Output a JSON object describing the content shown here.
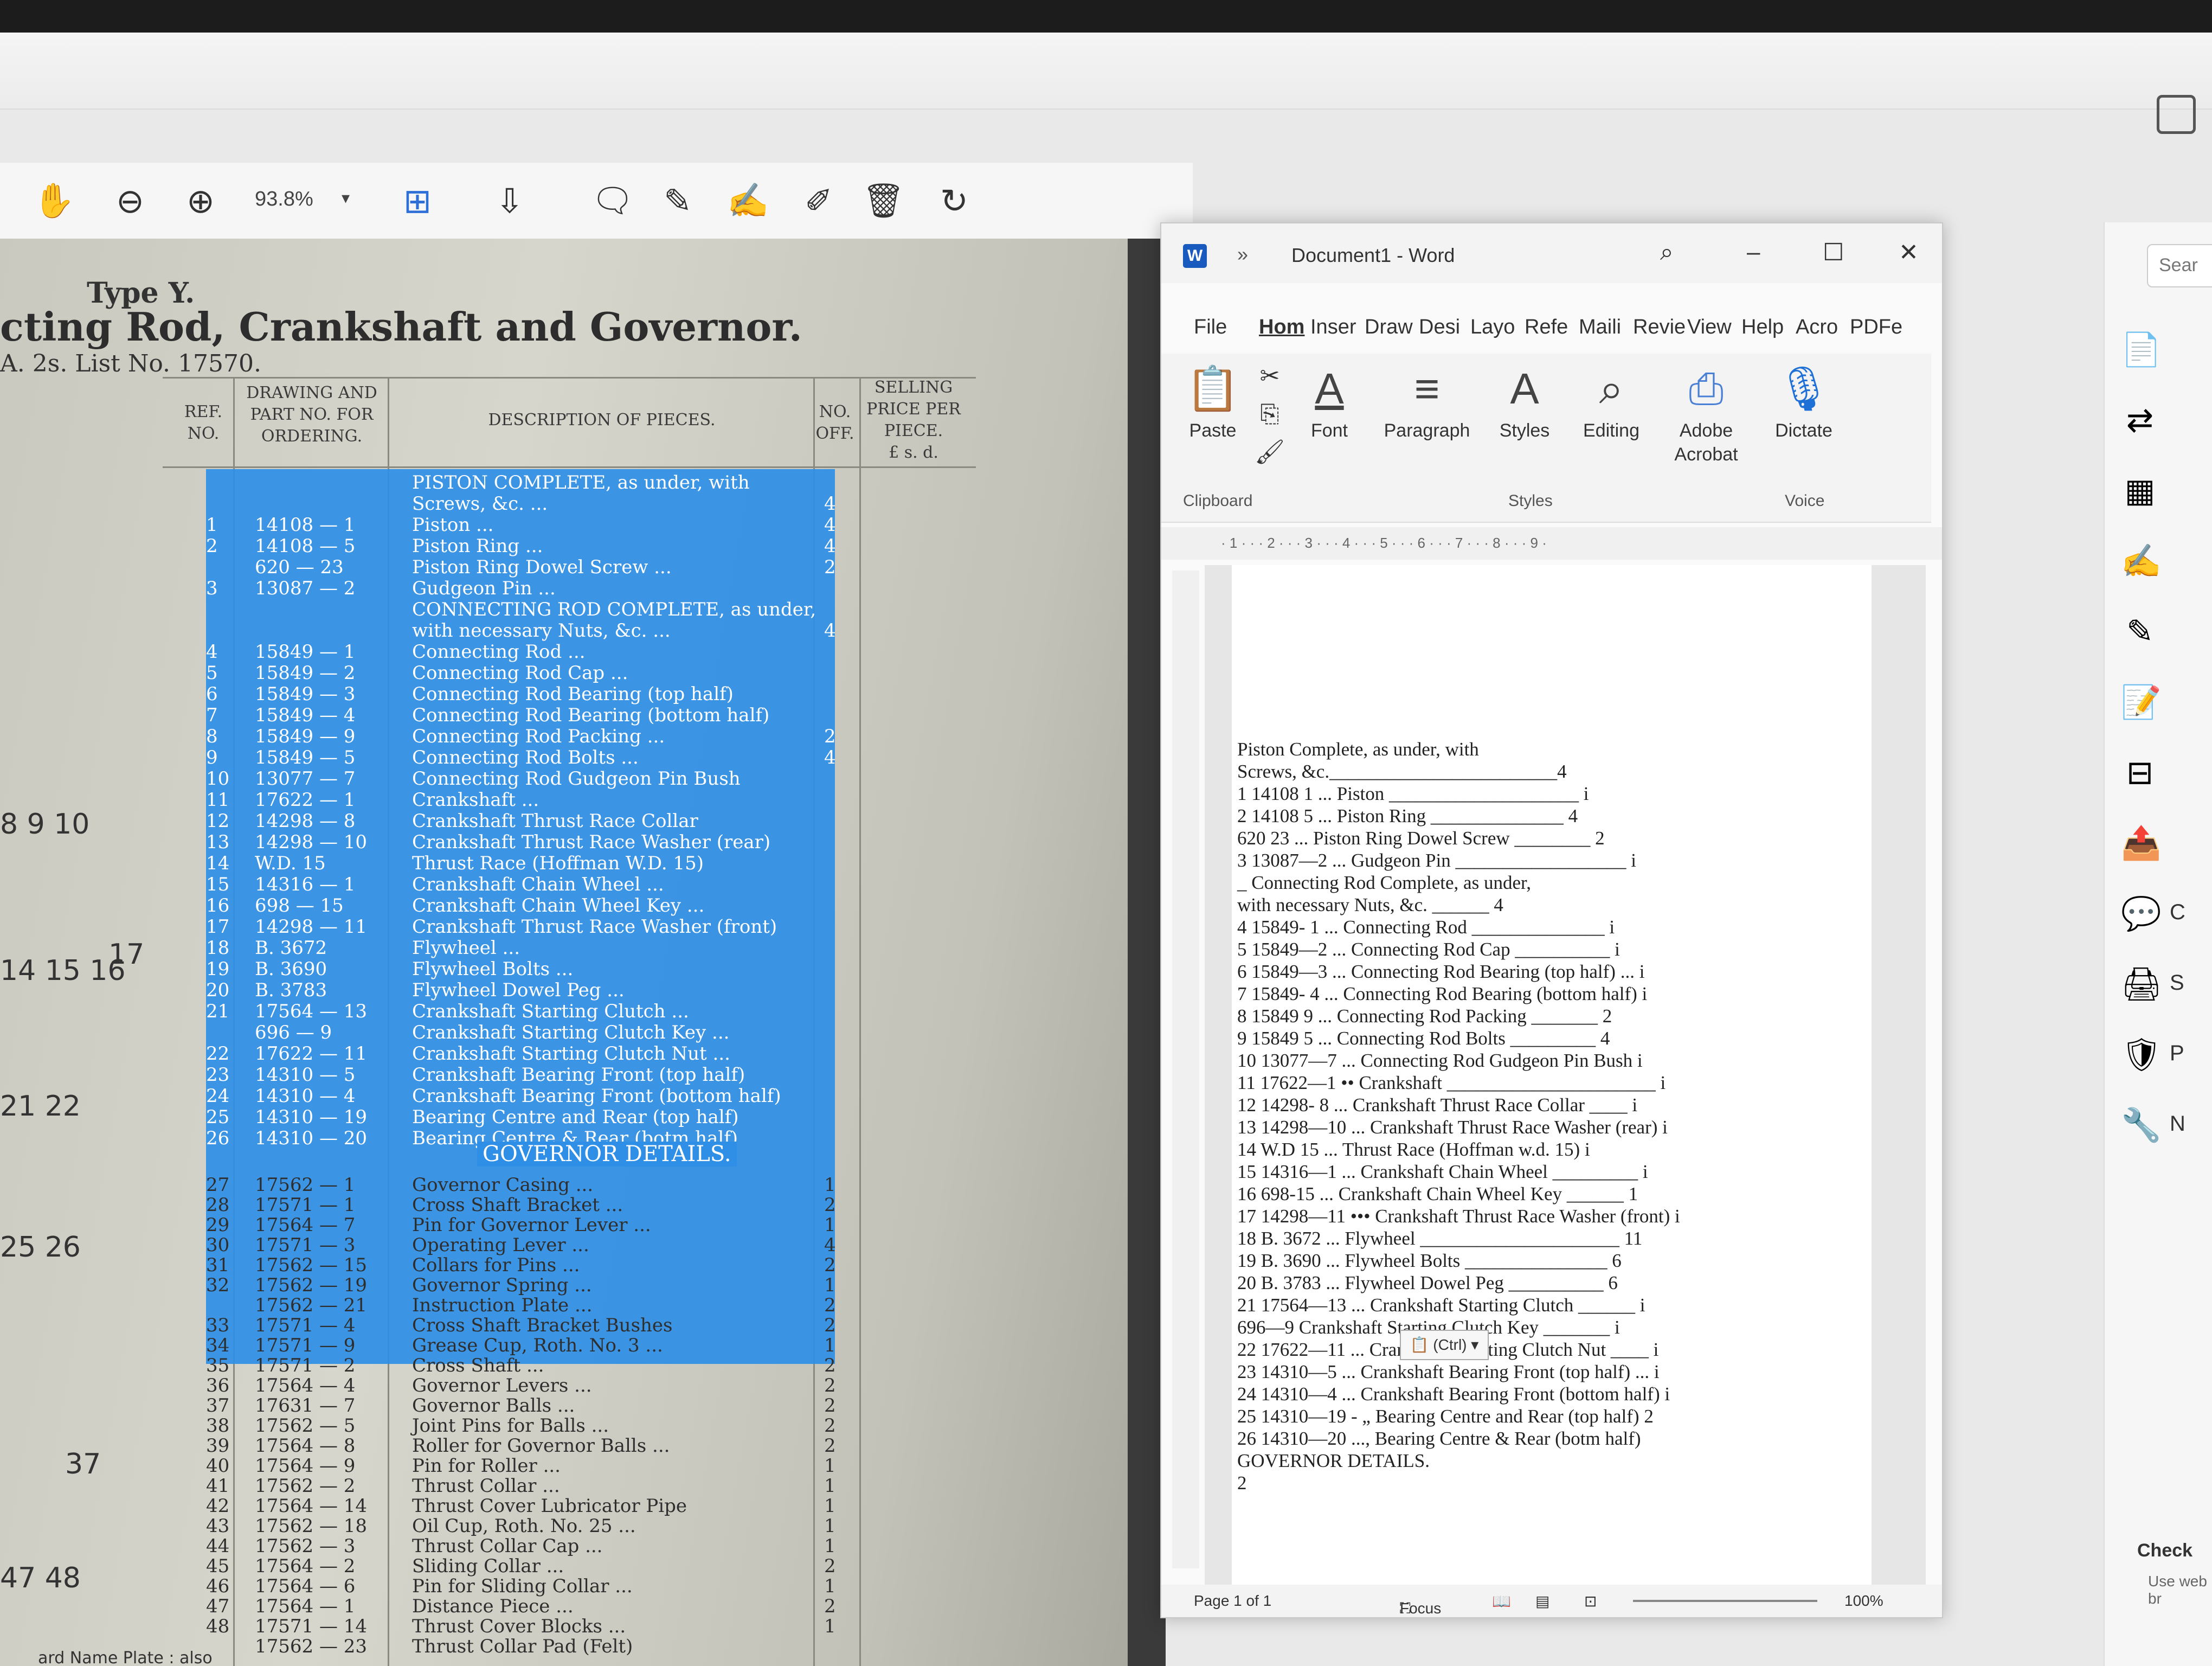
{
  "pdf_toolbar": {
    "zoom": "93.8%",
    "tools": [
      "hand-icon",
      "zoom-out-icon",
      "zoom-in-icon",
      "zoom-caret",
      "fit-page-icon",
      "scroll-mode-icon",
      "comment-icon",
      "highlight-icon",
      "sign-icon",
      "edit-icon",
      "delete-icon",
      "rotate-icon"
    ]
  },
  "scan": {
    "type_label": "Type Y.",
    "title": "cting  Rod,  Crankshaft  and  Governor.",
    "subtitle": "A.  2s.       List No. 17570.",
    "col_ref": "REF. NO.",
    "col_part": "DRAWING AND PART NO. FOR ORDERING.",
    "col_desc": "DESCRIPTION  OF  PIECES.",
    "col_no": "NO. OFF.",
    "col_price": "SELLING PRICE PER PIECE.",
    "col_price_units": "£  s.  d.",
    "figure_numbers": [
      "8   9   10",
      "14 15 16",
      "17",
      "21   22",
      "25   26",
      "37",
      "47   48"
    ],
    "footer": "ard Name Plate : also",
    "govern_title": "GOVERNOR  DETAILS.",
    "selected_rows": [
      {
        "ref": "",
        "part": "",
        "desc": "PISTON  COMPLETE,  as  under,  with",
        "no": ""
      },
      {
        "ref": "",
        "part": "",
        "desc": "Screws, &c. ...",
        "no": "4"
      },
      {
        "ref": "1",
        "part": "14108 — 1",
        "desc": "Piston ...",
        "no": "4"
      },
      {
        "ref": "2",
        "part": "14108 — 5",
        "desc": "Piston Ring ...",
        "no": "4"
      },
      {
        "ref": "",
        "part": "620 — 23",
        "desc": "Piston Ring Dowel Screw ...",
        "no": "2"
      },
      {
        "ref": "3",
        "part": "13087 — 2",
        "desc": "Gudgeon Pin ...",
        "no": ""
      },
      {
        "ref": "",
        "part": "",
        "desc": "CONNECTING ROD COMPLETE, as under,",
        "no": ""
      },
      {
        "ref": "",
        "part": "",
        "desc": "with necessary Nuts, &c. ...",
        "no": "4"
      },
      {
        "ref": "4",
        "part": "15849 — 1",
        "desc": "Connecting Rod ...",
        "no": ""
      },
      {
        "ref": "5",
        "part": "15849 — 2",
        "desc": "Connecting Rod Cap ...",
        "no": ""
      },
      {
        "ref": "6",
        "part": "15849 — 3",
        "desc": "Connecting Rod Bearing (top half)",
        "no": ""
      },
      {
        "ref": "7",
        "part": "15849 — 4",
        "desc": "Connecting Rod Bearing (bottom half)",
        "no": ""
      },
      {
        "ref": "8",
        "part": "15849 — 9",
        "desc": "Connecting Rod Packing ...",
        "no": "2"
      },
      {
        "ref": "9",
        "part": "15849 — 5",
        "desc": "Connecting Rod Bolts ...",
        "no": "4"
      },
      {
        "ref": "10",
        "part": "13077 — 7",
        "desc": "Connecting Rod Gudgeon Pin Bush",
        "no": ""
      },
      {
        "ref": "11",
        "part": "17622 — 1",
        "desc": "Crankshaft ...",
        "no": ""
      },
      {
        "ref": "12",
        "part": "14298 — 8",
        "desc": "Crankshaft Thrust Race Collar",
        "no": ""
      },
      {
        "ref": "13",
        "part": "14298 — 10",
        "desc": "Crankshaft Thrust Race Washer (rear)",
        "no": ""
      },
      {
        "ref": "14",
        "part": "W.D. 15",
        "desc": "Thrust Race (Hoffman W.D. 15)",
        "no": ""
      },
      {
        "ref": "15",
        "part": "14316 — 1",
        "desc": "Crankshaft Chain Wheel ...",
        "no": ""
      },
      {
        "ref": "16",
        "part": "698 — 15",
        "desc": "Crankshaft Chain Wheel Key ...",
        "no": ""
      },
      {
        "ref": "17",
        "part": "14298 — 11",
        "desc": "Crankshaft Thrust Race Washer (front)",
        "no": ""
      },
      {
        "ref": "18",
        "part": "B. 3672",
        "desc": "Flywheel ...",
        "no": ""
      },
      {
        "ref": "19",
        "part": "B. 3690",
        "desc": "Flywheel Bolts ...",
        "no": ""
      },
      {
        "ref": "20",
        "part": "B. 3783",
        "desc": "Flywheel Dowel Peg ...",
        "no": ""
      },
      {
        "ref": "21",
        "part": "17564 — 13",
        "desc": "Crankshaft Starting Clutch ...",
        "no": ""
      },
      {
        "ref": "",
        "part": "696 — 9",
        "desc": "Crankshaft Starting Clutch Key ...",
        "no": ""
      },
      {
        "ref": "22",
        "part": "17622 — 11",
        "desc": "Crankshaft Starting Clutch Nut ...",
        "no": ""
      },
      {
        "ref": "23",
        "part": "14310 — 5",
        "desc": "Crankshaft Bearing Front (top half)",
        "no": ""
      },
      {
        "ref": "24",
        "part": "14310 — 4",
        "desc": "Crankshaft Bearing Front (bottom half)",
        "no": ""
      },
      {
        "ref": "25",
        "part": "14310 — 19",
        "desc": "Bearing Centre and Rear (top half)",
        "no": ""
      },
      {
        "ref": "26",
        "part": "14310 — 20",
        "desc": "Bearing Centre & Rear (botm half)",
        "no": ""
      }
    ],
    "governor_rows": [
      {
        "ref": "27",
        "part": "17562 — 1",
        "desc": "Governor Casing ...",
        "no": "1"
      },
      {
        "ref": "28",
        "part": "17571 — 1",
        "desc": "Cross Shaft Bracket ...",
        "no": "2"
      },
      {
        "ref": "29",
        "part": "17564 — 7",
        "desc": "Pin for Governor Lever ...",
        "no": "1"
      },
      {
        "ref": "30",
        "part": "17571 — 3",
        "desc": "Operating Lever ...",
        "no": "4"
      },
      {
        "ref": "31",
        "part": "17562 — 15",
        "desc": "Collars for Pins ...",
        "no": "2"
      },
      {
        "ref": "32",
        "part": "17562 — 19",
        "desc": "Governor Spring ...",
        "no": "1"
      },
      {
        "ref": "",
        "part": "17562 — 21",
        "desc": "Instruction Plate ...",
        "no": "2"
      },
      {
        "ref": "33",
        "part": "17571 — 4",
        "desc": "Cross Shaft Bracket Bushes",
        "no": "2"
      },
      {
        "ref": "34",
        "part": "17571 — 9",
        "desc": "Grease Cup, Roth. No. 3 ...",
        "no": "1"
      },
      {
        "ref": "35",
        "part": "17571 — 2",
        "desc": "Cross Shaft ...",
        "no": "2"
      },
      {
        "ref": "36",
        "part": "17564 — 4",
        "desc": "Governor Levers ...",
        "no": "2"
      },
      {
        "ref": "37",
        "part": "17631 — 7",
        "desc": "Governor Balls ...",
        "no": "2"
      },
      {
        "ref": "38",
        "part": "17562 — 5",
        "desc": "Joint Pins for Balls ...",
        "no": "2"
      },
      {
        "ref": "39",
        "part": "17564 — 8",
        "desc": "Roller for Governor Balls ...",
        "no": "2"
      },
      {
        "ref": "40",
        "part": "17564 — 9",
        "desc": "Pin for Roller ...",
        "no": "1"
      },
      {
        "ref": "41",
        "part": "17562 — 2",
        "desc": "Thrust Collar ...",
        "no": "1"
      },
      {
        "ref": "42",
        "part": "17564 — 14",
        "desc": "Thrust Cover Lubricator Pipe",
        "no": "1"
      },
      {
        "ref": "43",
        "part": "17562 — 18",
        "desc": "Oil Cup, Roth. No. 25 ...",
        "no": "1"
      },
      {
        "ref": "44",
        "part": "17562 — 3",
        "desc": "Thrust Collar Cap ...",
        "no": "1"
      },
      {
        "ref": "45",
        "part": "17564 — 2",
        "desc": "Sliding Collar ...",
        "no": "2"
      },
      {
        "ref": "46",
        "part": "17564 — 6",
        "desc": "Pin for Sliding Collar ...",
        "no": "1"
      },
      {
        "ref": "47",
        "part": "17564 — 1",
        "desc": "Distance Piece ...",
        "no": "2"
      },
      {
        "ref": "48",
        "part": "17571 — 14",
        "desc": "Thrust Cover Blocks ...",
        "no": "1"
      },
      {
        "ref": "",
        "part": "17562 — 23",
        "desc": "Thrust Collar Pad (Felt)",
        "no": ""
      }
    ]
  },
  "word": {
    "title": "Document1  -  Word",
    "menu": [
      "File",
      "Hom",
      "Inser",
      "Draw",
      "Desi",
      "Layo",
      "Refe",
      "Maili",
      "Revie",
      "View",
      "Help",
      "Acro",
      "PDFe"
    ],
    "ribbon": {
      "paste": "Paste",
      "font": "Font",
      "paragraph": "Paragraph",
      "styles": "Styles",
      "editing": "Editing",
      "adobe": "Adobe Acrobat",
      "dictate": "Dictate",
      "group_clipboard": "Clipboard",
      "group_styles": "Styles",
      "group_voice": "Voice"
    },
    "ruler": "· 1 · · · 2 · · · 3 · · · 4 · · · 5 · · · 6 · · · 7 · · · 8 · · · 9 ·",
    "doc_lines": [
      "Piston Complete, as under, with",
      "Screws, &c.________________________4",
      "1 14108 1 ... Piston ____________________ i",
      "2 14108 5 ... Piston Ring ______________ 4",
      "620 23 ... Piston Ring Dowel Screw ________ 2",
      "3 13087—2 ... Gudgeon Pin __________________ i",
      "_ Connecting Rod Complete, as under,",
      "with necessary Nuts, &c. ______ 4",
      "4 15849- 1 ... Connecting Rod ______________ i",
      "5 15849—2 ... Connecting Rod Cap __________ i",
      "6 15849—3 ... Connecting Rod Bearing (top half) ... i",
      "7 15849- 4 ... Connecting Rod Bearing (bottom half) i",
      "8 15849 9 ... Connecting Rod Packing _______ 2",
      "9 15849 5 ... Connecting Rod Bolts _________ 4",
      "10 13077—7 ... Connecting Rod Gudgeon Pin Bush i",
      "11 17622—1 •• Crankshaft ______________________ i",
      "12 14298- 8 ... Crankshaft Thrust Race Collar ____ i",
      "13 14298—10 ... Crankshaft Thrust Race Washer (rear) i",
      "14 W.D 15 ... Thrust Race (Hoffman w.d. 15) i",
      "15 14316—1 ... Crankshaft Chain Wheel _________ i",
      "16 698-15 ... Crankshaft Chain Wheel Key ______ 1",
      "17 14298—11 ••• Crankshaft Thrust Race Washer (front) i",
      "18 B. 3672 ... Flywheel _____________________ 11",
      "19 B. 3690 ... Flywheel Bolts _______________ 6",
      "20 B. 3783 ... Flywheel Dowel Peg __________ 6",
      "21 17564—13 ... Crankshaft Starting Clutch ______ i",
      "696—9 Crankshaft Starting Clutch Key _______ i",
      "22 17622—11 ... Crankshaft Starting Clutch Nut ____ i",
      "23 14310—5 ... Crankshaft Bearing Front (top half) ... i",
      "24 14310—4 ... Crankshaft Bearing Front (bottom half) i",
      "25 14310—19 - „ Bearing Centre and Rear (top half) 2",
      "26 14310—20 ..., Bearing Centre & Rear (botm half)",
      "GOVERNOR DETAILS.",
      "2"
    ],
    "paste_options": "(Ctrl)",
    "status_page": "Page 1 of 1",
    "status_focus": "Focus",
    "status_zoom": "100%"
  },
  "acrobat_rail": {
    "search_placeholder": "Sear",
    "panel_title": "Check",
    "panel_sub": "Use web br",
    "icons": [
      "create-pdf-icon",
      "export-pdf-icon",
      "organize-icon",
      "fill-sign-icon",
      "request-sign-icon",
      "edit-pdf-icon",
      "combine-icon",
      "export-icon",
      "comment-icon",
      "print-icon",
      "protect-icon",
      "tools-icon"
    ],
    "labels": [
      "",
      "",
      "",
      "",
      "",
      "",
      "",
      "",
      "C",
      "S",
      "P",
      "N"
    ]
  }
}
